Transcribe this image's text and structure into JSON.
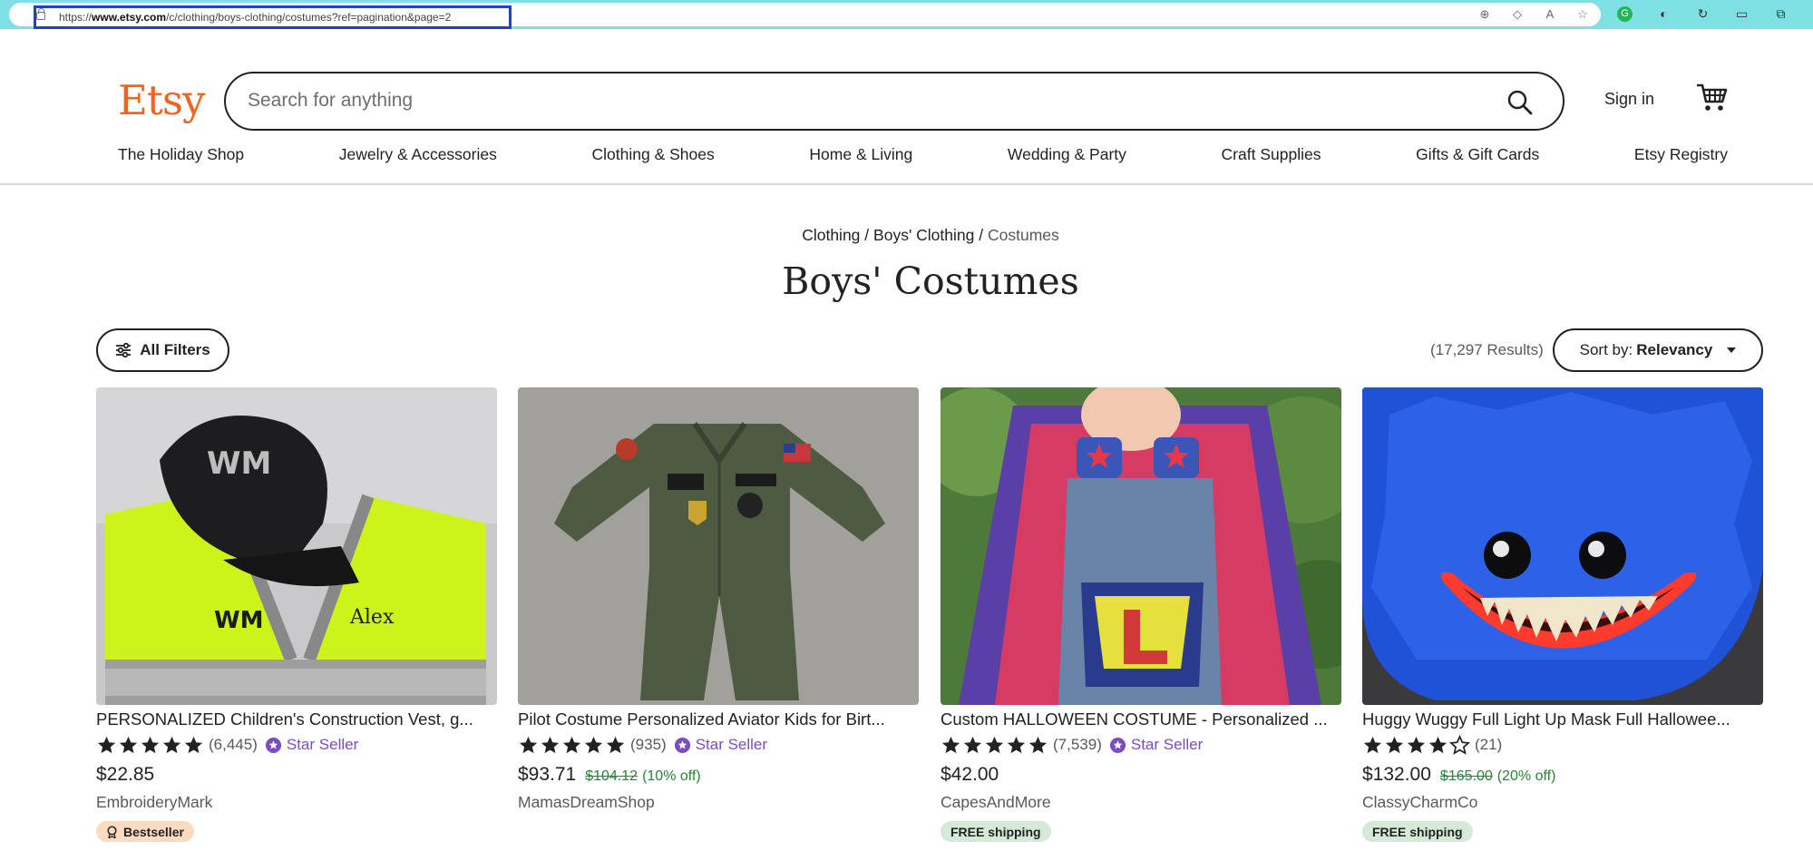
{
  "browser": {
    "url_prefix": "https://",
    "url_domain": "www.etsy.com",
    "url_path": "/c/clothing/boys-clothing/costumes?ref=pagination&page=2"
  },
  "header": {
    "logo": "Etsy",
    "search_placeholder": "Search for anything",
    "sign_in": "Sign in"
  },
  "nav": [
    {
      "label": "The Holiday Shop"
    },
    {
      "label": "Jewelry & Accessories"
    },
    {
      "label": "Clothing & Shoes"
    },
    {
      "label": "Home & Living"
    },
    {
      "label": "Wedding & Party"
    },
    {
      "label": "Craft Supplies"
    },
    {
      "label": "Gifts & Gift Cards"
    },
    {
      "label": "Etsy Registry"
    }
  ],
  "breadcrumb": {
    "level1": "Clothing",
    "sep": "/",
    "level2": "Boys' Clothing",
    "current": "Costumes"
  },
  "page_title": "Boys' Costumes",
  "controls": {
    "filters_label": "All Filters",
    "results": "(17,297 Results)",
    "sort_prefix": "Sort by:",
    "sort_value": "Relevancy"
  },
  "products": [
    {
      "title": "PERSONALIZED Children's Construction Vest, g...",
      "rating": 5,
      "count": "(6,445)",
      "star_seller": "Star Seller",
      "price": "$22.85",
      "shop": "EmbroideryMark",
      "badge": "Bestseller"
    },
    {
      "title": "Pilot Costume Personalized Aviator Kids for Birt...",
      "rating": 5,
      "count": "(935)",
      "star_seller": "Star Seller",
      "price": "$93.71",
      "original_price": "$104.12",
      "discount": "(10% off)",
      "shop": "MamasDreamShop"
    },
    {
      "title": "Custom HALLOWEEN COSTUME - Personalized ...",
      "rating": 5,
      "count": "(7,539)",
      "star_seller": "Star Seller",
      "price": "$42.00",
      "shop": "CapesAndMore",
      "badge": "FREE shipping"
    },
    {
      "title": "Huggy Wuggy Full Light Up Mask Full Hallowee...",
      "rating": 4,
      "count": "(21)",
      "price": "$132.00",
      "original_price": "$165.00",
      "discount": "(20% off)",
      "shop": "ClassyCharmCo",
      "badge": "FREE shipping"
    }
  ],
  "colors": {
    "brand": "#f1641e",
    "star_seller": "#7c4cc4",
    "sale_green": "#258635",
    "url_highlight": "#1f3fd6"
  }
}
